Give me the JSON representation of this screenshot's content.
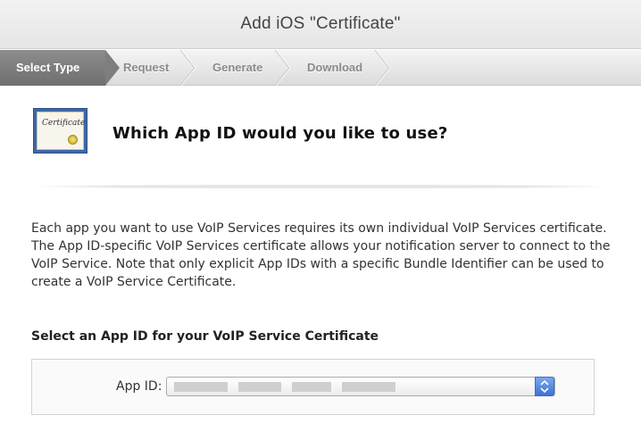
{
  "window": {
    "title": "Add iOS \"Certificate\""
  },
  "steps": [
    {
      "label": "Select Type",
      "active": true
    },
    {
      "label": "Request",
      "active": false
    },
    {
      "label": "Generate",
      "active": false
    },
    {
      "label": "Download",
      "active": false
    }
  ],
  "certificate_icon": {
    "text": "Certificate",
    "icon": "certificate-icon"
  },
  "main": {
    "question": "Which App ID would you like to use?",
    "description_lines": [
      "Each app you want to use VoIP Services requires its own individual VoIP Services certificate.",
      "The App ID-specific VoIP Services certificate allows your notification server to connect to the",
      "VoIP Service. Note that only explicit App IDs with a specific Bundle Identifier can be used to",
      "create a VoIP Service Certificate."
    ],
    "select_heading": "Select an App ID for your VoIP Service Certificate",
    "app_id_label": "App ID:",
    "app_id_value": ""
  },
  "colors": {
    "active_step": "#7e7e7e",
    "select_arrow": "#3b73d6",
    "certificate_frame": "#3f67a8"
  }
}
